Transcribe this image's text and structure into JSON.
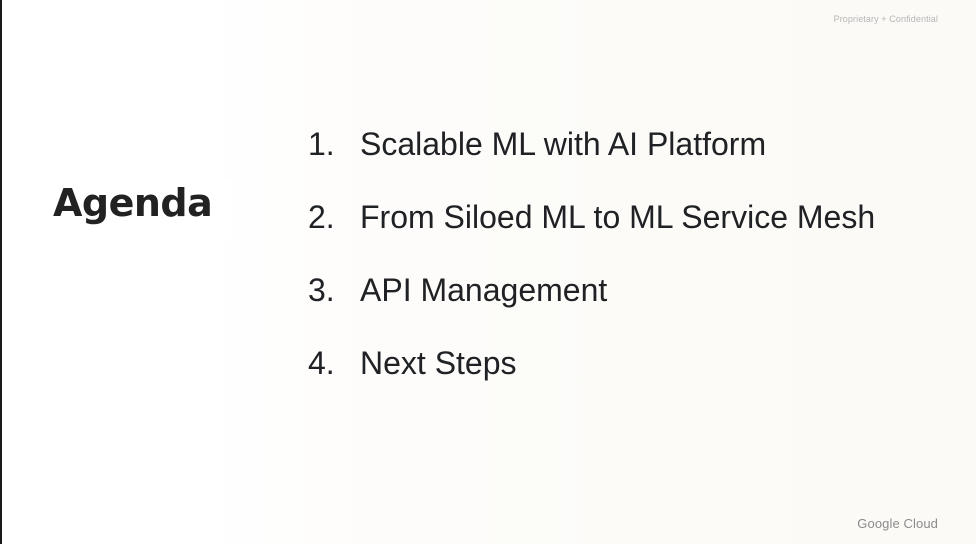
{
  "header": {
    "confidential_label": "Proprietary + Confidential"
  },
  "slide": {
    "title": "Agenda",
    "items": [
      {
        "number": "1.",
        "label": "Scalable ML with AI Platform"
      },
      {
        "number": "2.",
        "label": "From Siloed ML to ML Service Mesh"
      },
      {
        "number": "3.",
        "label": "API Management"
      },
      {
        "number": "4.",
        "label": "Next Steps"
      }
    ]
  },
  "footer": {
    "logo_text": "Google Cloud"
  }
}
